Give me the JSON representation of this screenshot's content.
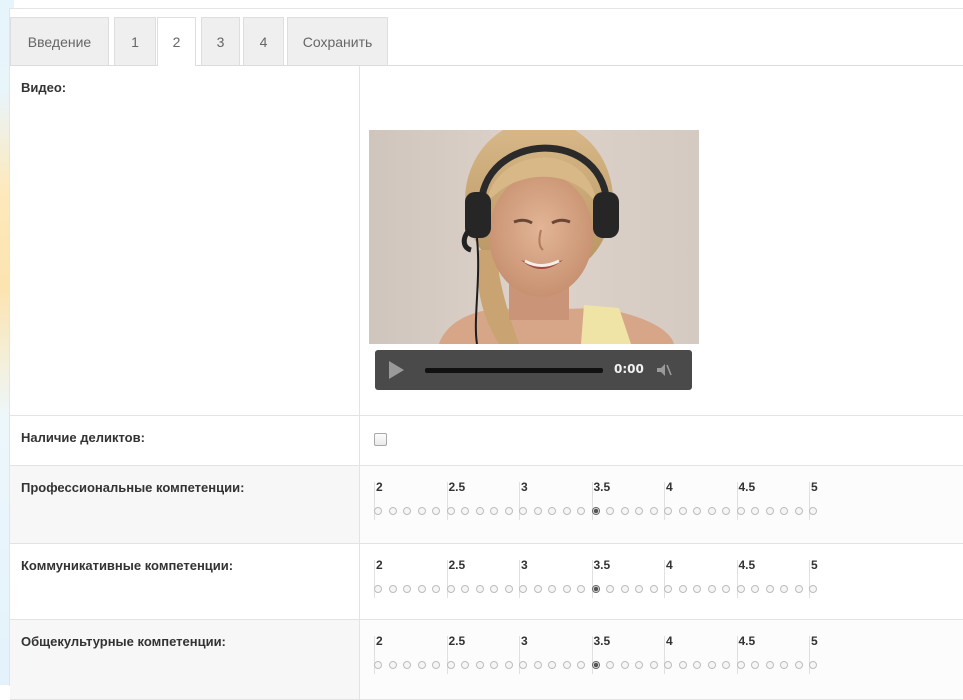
{
  "tabs": [
    {
      "label": "Введение",
      "active": false
    },
    {
      "label": "1",
      "active": false
    },
    {
      "label": "2",
      "active": true
    },
    {
      "label": "3",
      "active": false
    },
    {
      "label": "4",
      "active": false
    },
    {
      "label": "Сохранить",
      "active": false
    }
  ],
  "form": {
    "video": {
      "label": "Видео:",
      "time": "0:00",
      "icons": [
        "play-icon",
        "mute-icon"
      ]
    },
    "offenses": {
      "label": "Наличие деликтов:",
      "checked": false
    },
    "scale": {
      "labels": [
        "2",
        "2.5",
        "3",
        "3.5",
        "4",
        "4.5",
        "5"
      ],
      "steps": 31
    },
    "ratings": [
      {
        "label": "Профессиональные компетенции:",
        "value": 3.5
      },
      {
        "label": "Коммуникативные компетенции:",
        "value": 3.5
      },
      {
        "label": "Общекультурные компетенции:",
        "value": 3.5
      }
    ]
  },
  "colors": {
    "active_tab_underline": "#ffffff",
    "player_bar": "#4a4a4a"
  }
}
